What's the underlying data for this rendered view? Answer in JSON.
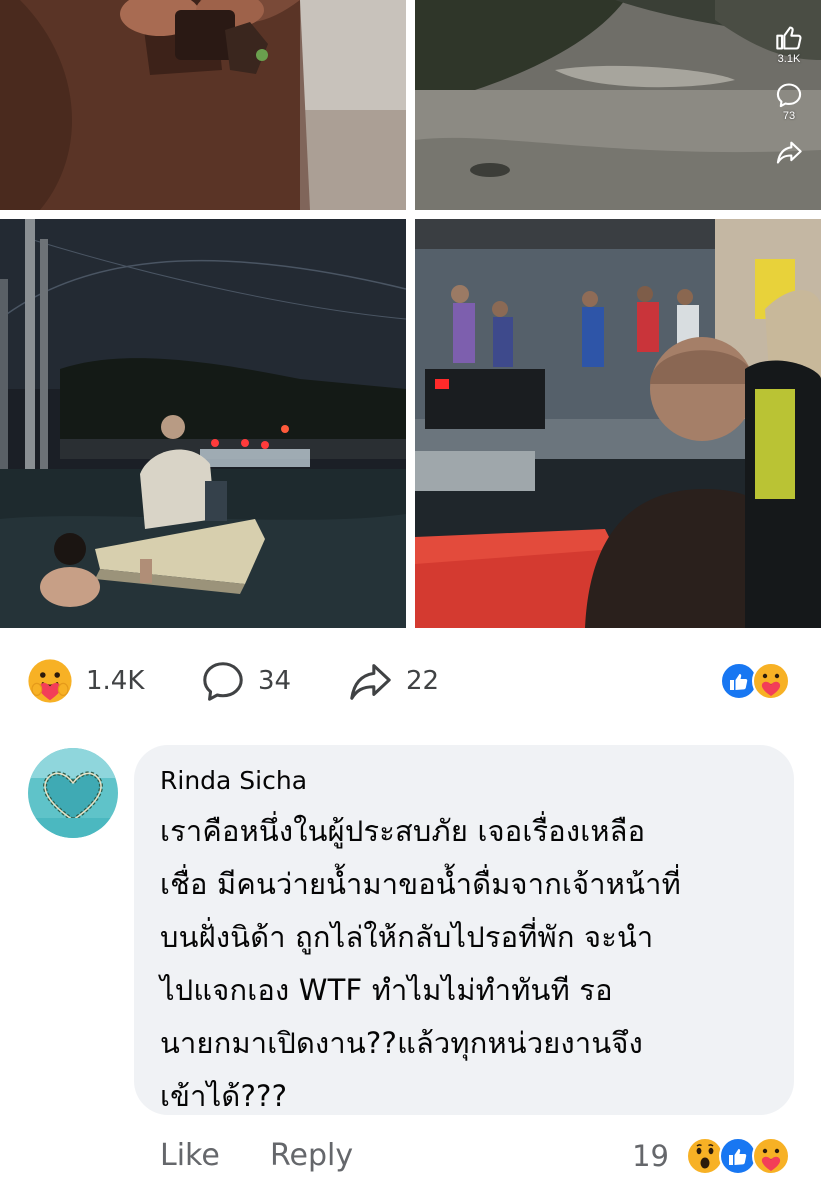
{
  "post": {
    "reel": {
      "like_count": "3.1K",
      "comment_count": "73"
    },
    "reactions": {
      "count": "1.4K",
      "comments": "34",
      "shares": "22",
      "summary_icons": [
        "like-icon",
        "care-icon"
      ]
    }
  },
  "comment": {
    "author": "Rinda Sicha",
    "text": "เราคือหนึ่งในผู้ประสบภัย เจอเรื่องเหลือ\nเชื่อ มีคนว่ายน้ำมาขอน้ำดื่มจากเจ้าหน้าที่\nบนฝั่งนิด้า ถูกไล่ให้กลับไปรอที่พัก จะนำ\nไปแจกเอง WTF ทำไมไม่ทำทันที รอ\nนายกมาเปิดงาน??แล้วทุกหน่วยงานจึง\nเข้าได้???",
    "actions": {
      "like_label": "Like",
      "reply_label": "Reply"
    },
    "reaction_count": "19",
    "reaction_icons": [
      "wow-icon",
      "like-icon",
      "care-icon"
    ]
  },
  "colors": {
    "bubble_bg": "#f0f2f5",
    "meta_text": "#65676b",
    "like_blue": "#1877f2",
    "care_yellow": "#f7b125",
    "care_heart": "#f33e58"
  }
}
